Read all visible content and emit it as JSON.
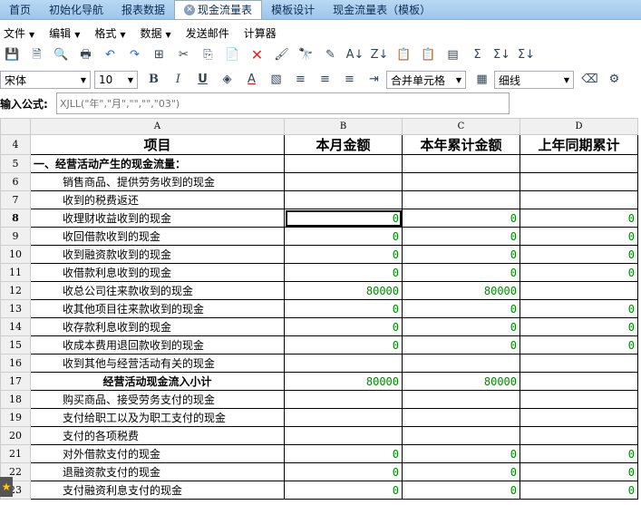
{
  "tabs": [
    {
      "label": "首页"
    },
    {
      "label": "初始化导航"
    },
    {
      "label": "报表数据"
    },
    {
      "label": "现金流量表",
      "active": true
    },
    {
      "label": "模板设计"
    },
    {
      "label": "现金流量表（模板）"
    }
  ],
  "menu": [
    {
      "label": "文件",
      "dropdown": true
    },
    {
      "label": "编辑",
      "dropdown": true
    },
    {
      "label": "格式",
      "dropdown": true
    },
    {
      "label": "数据",
      "dropdown": true
    },
    {
      "label": "发送邮件"
    },
    {
      "label": "计算器"
    }
  ],
  "toolbar": {
    "font": "宋体",
    "size": "10",
    "merge": "合并单元格",
    "border": "细线"
  },
  "formula": {
    "label": "输入公式:",
    "placeholder": "XJLL(\"年\",\"月\",\"\",\"\",\"03\")"
  },
  "columns": [
    "A",
    "B",
    "C",
    "D"
  ],
  "rows": [
    {
      "n": "4",
      "a": "项目",
      "b": "本月金额",
      "c": "本年累计金额",
      "d": "上年同期累计",
      "t": "hd"
    },
    {
      "n": "5",
      "a": "一、经营活动产生的现金流量：",
      "b": "",
      "c": "",
      "d": "",
      "t": "bold"
    },
    {
      "n": "6",
      "a": "销售商品、提供劳务收到的现金",
      "b": "",
      "c": "",
      "d": "",
      "t": "ind"
    },
    {
      "n": "7",
      "a": "收到的税费返还",
      "b": "",
      "c": "",
      "d": "",
      "t": "ind"
    },
    {
      "n": "8",
      "a": "收理财收益收到的现金",
      "b": "0",
      "c": "0",
      "d": "0",
      "t": "ind"
    },
    {
      "n": "9",
      "a": "收回借款收到的现金",
      "b": "0",
      "c": "0",
      "d": "0",
      "t": "ind"
    },
    {
      "n": "10",
      "a": "收到融资款收到的现金",
      "b": "0",
      "c": "0",
      "d": "0",
      "t": "ind"
    },
    {
      "n": "11",
      "a": "收借款利息收到的现金",
      "b": "0",
      "c": "0",
      "d": "0",
      "t": "ind"
    },
    {
      "n": "12",
      "a": "收总公司往来款收到的现金",
      "b": "80000",
      "c": "80000",
      "d": "",
      "t": "ind"
    },
    {
      "n": "13",
      "a": "收其他项目往来款收到的现金",
      "b": "0",
      "c": "0",
      "d": "0",
      "t": "ind"
    },
    {
      "n": "14",
      "a": "收存款利息收到的现金",
      "b": "0",
      "c": "0",
      "d": "0",
      "t": "ind"
    },
    {
      "n": "15",
      "a": "收成本费用退回款收到的现金",
      "b": "0",
      "c": "0",
      "d": "0",
      "t": "ind"
    },
    {
      "n": "16",
      "a": "收到其他与经营活动有关的现金",
      "b": "",
      "c": "",
      "d": "",
      "t": "ind"
    },
    {
      "n": "17",
      "a": "经营活动现金流入小计",
      "b": "80000",
      "c": "80000",
      "d": "",
      "t": "ctr"
    },
    {
      "n": "18",
      "a": "购买商品、接受劳务支付的现金",
      "b": "",
      "c": "",
      "d": "",
      "t": "ind"
    },
    {
      "n": "19",
      "a": "支付给职工以及为职工支付的现金",
      "b": "",
      "c": "",
      "d": "",
      "t": "ind"
    },
    {
      "n": "20",
      "a": "支付的各项税费",
      "b": "",
      "c": "",
      "d": "",
      "t": "ind"
    },
    {
      "n": "21",
      "a": "对外借款支付的现金",
      "b": "0",
      "c": "0",
      "d": "0",
      "t": "ind"
    },
    {
      "n": "22",
      "a": "退融资款支付的现金",
      "b": "0",
      "c": "0",
      "d": "0",
      "t": "ind"
    },
    {
      "n": "23",
      "a": "支付融资利息支付的现金",
      "b": "0",
      "c": "0",
      "d": "0",
      "t": "ind"
    }
  ],
  "selected_cell": "B8"
}
